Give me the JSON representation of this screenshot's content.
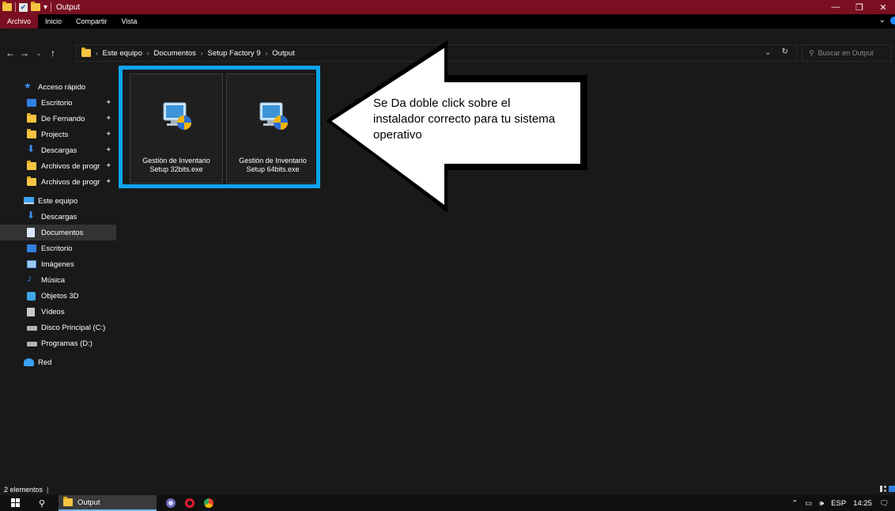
{
  "window": {
    "title": "Output",
    "controls": {
      "minimize": "—",
      "maximize": "❐",
      "close": "✕"
    }
  },
  "ribbon": {
    "tabs": [
      "Archivo",
      "Inicio",
      "Compartir",
      "Vista"
    ],
    "active_tab": "Archivo",
    "active_color": "#7a0f22"
  },
  "address": {
    "crumbs": [
      "Este equipo",
      "Documentos",
      "Setup Factory 9",
      "Output"
    ],
    "search_placeholder": "Buscar en Output"
  },
  "sidebar": {
    "quick_access": {
      "label": "Acceso rápido",
      "items": [
        {
          "label": "Escritorio",
          "icon": "desktop-icon",
          "pinned": true
        },
        {
          "label": "De Fernando",
          "icon": "folder-icon",
          "pinned": true
        },
        {
          "label": "Projects",
          "icon": "folder-icon",
          "pinned": true
        },
        {
          "label": "Descargas",
          "icon": "download-icon",
          "pinned": true
        },
        {
          "label": "Archivos de progr",
          "icon": "folder-icon",
          "pinned": true
        },
        {
          "label": "Archivos de progr",
          "icon": "folder-icon",
          "pinned": true
        }
      ]
    },
    "this_pc": {
      "label": "Este equipo",
      "items": [
        {
          "label": "Descargas",
          "icon": "download-icon"
        },
        {
          "label": "Documentos",
          "icon": "document-icon",
          "selected": true
        },
        {
          "label": "Escritorio",
          "icon": "desktop-icon"
        },
        {
          "label": "Imágenes",
          "icon": "pictures-icon"
        },
        {
          "label": "Música",
          "icon": "music-icon"
        },
        {
          "label": "Objetos 3D",
          "icon": "3d-objects-icon"
        },
        {
          "label": "Vídeos",
          "icon": "videos-icon"
        },
        {
          "label": "Disco Principal (C:)",
          "icon": "system-drive-icon"
        },
        {
          "label": "Programas (D:)",
          "icon": "drive-icon"
        }
      ]
    },
    "network": {
      "label": "Red",
      "icon": "network-icon"
    }
  },
  "files": [
    {
      "name_line1": "Gestión de Inventario",
      "name_line2": "Setup 32bits.exe",
      "icon": "installer-icon"
    },
    {
      "name_line1": "Gestión de Inventario",
      "name_line2": "Setup 64bits.exe",
      "icon": "installer-icon"
    }
  ],
  "callout": {
    "line1": "Se Da doble click sobre el",
    "line2": "instalador correcto para tu sistema",
    "line3": "operativo",
    "highlight_color": "#0da3ec"
  },
  "status": {
    "count": "2 elementos",
    "separator": "|"
  },
  "taskbar": {
    "active_task": "Output",
    "language": "ESP",
    "time": "14:25"
  }
}
